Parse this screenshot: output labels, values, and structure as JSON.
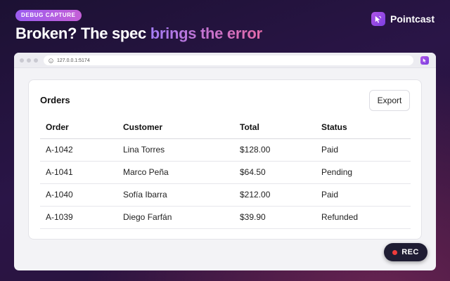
{
  "badge": "DEBUG CAPTURE",
  "headline": {
    "part1": "Broken? The spec ",
    "part2": "brings the error"
  },
  "brand": {
    "name": "Pointcast",
    "logo_icon": "cursor-icon"
  },
  "browser": {
    "url": "127.0.0.1:5174"
  },
  "orders": {
    "title": "Orders",
    "export_label": "Export",
    "columns": [
      "Order",
      "Customer",
      "Total",
      "Status"
    ],
    "rows": [
      [
        "A-1042",
        "Lina Torres",
        "$128.00",
        "Paid"
      ],
      [
        "A-1041",
        "Marco Peña",
        "$64.50",
        "Pending"
      ],
      [
        "A-1040",
        "Sofía Ibarra",
        "$212.00",
        "Paid"
      ],
      [
        "A-1039",
        "Diego Farfán",
        "$39.90",
        "Refunded"
      ]
    ]
  },
  "recorder": {
    "label": "REC",
    "dot_color": "#ef3b3b"
  }
}
